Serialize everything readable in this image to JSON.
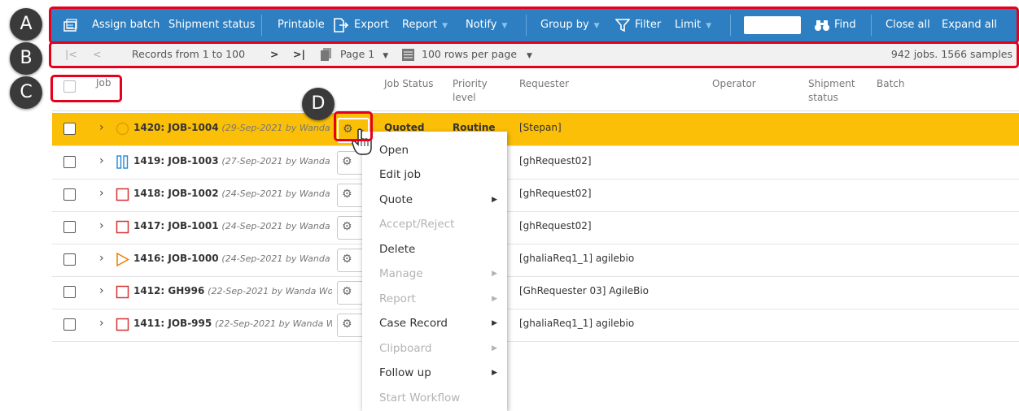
{
  "colors": {
    "toolbar": "#2d7fc1",
    "selected_row": "#fbbf08",
    "callout_border": "#e5001c",
    "badge": "#3a3a3a"
  },
  "callouts": {
    "a": "A",
    "b": "B",
    "c": "C",
    "d": "D"
  },
  "toolbar": {
    "assign_batch": "Assign batch",
    "shipment_status": "Shipment status",
    "printable": "Printable",
    "export": "Export",
    "report": "Report",
    "notify": "Notify",
    "group_by": "Group by",
    "filter": "Filter",
    "limit": "Limit",
    "find_value": "",
    "find": "Find",
    "close_all": "Close all",
    "expand_all": "Expand all"
  },
  "pager": {
    "records": "Records from 1 to 100",
    "page": "Page 1",
    "rows_per_page": "100 rows per page",
    "summary": "942 jobs. 1566 samples"
  },
  "columns": {
    "job": "Job",
    "job_status": "Job Status",
    "priority": "Priority level",
    "requester": "Requester",
    "operator": "Operator",
    "shipment": "Shipment status",
    "batch": "Batch"
  },
  "rows": [
    {
      "id": "1420: JOB-1004",
      "meta": "(29-Sep-2021 by Wanda Won",
      "status": "Quoted",
      "priority": "Routine",
      "requester": "[Stepan]",
      "icon": "circle-outline-icon"
    },
    {
      "id": "1419: JOB-1003",
      "meta": "(27-Sep-2021 by Wanda Wong",
      "requester": "[ghRequest02]",
      "icon": "pause-icon"
    },
    {
      "id": "1418: JOB-1002",
      "meta": "(24-Sep-2021 by Wanda Wong",
      "requester": "[ghRequest02]",
      "icon": "square-outline-icon"
    },
    {
      "id": "1417: JOB-1001",
      "meta": "(24-Sep-2021 by Wanda Wong",
      "requester": "[ghRequest02]",
      "icon": "square-outline-icon"
    },
    {
      "id": "1416: JOB-1000",
      "meta": "(24-Sep-2021 by Wanda Wong",
      "requester": "[ghaliaReq1_1] agilebio",
      "icon": "play-outline-icon"
    },
    {
      "id": "1412: GH996",
      "meta": "(22-Sep-2021 by Wanda Wong)",
      "requester": "[GhRequester 03] AgileBio",
      "icon": "square-outline-icon"
    },
    {
      "id": "1411: JOB-995",
      "meta": "(22-Sep-2021 by Wanda Wong)",
      "requester": "[ghaliaReq1_1] agilebio",
      "icon": "square-outline-icon"
    }
  ],
  "menu": [
    {
      "label": "Open",
      "disabled": false,
      "submenu": false
    },
    {
      "label": "Edit job",
      "disabled": false,
      "submenu": false
    },
    {
      "label": "Quote",
      "disabled": false,
      "submenu": true
    },
    {
      "label": "Accept/Reject",
      "disabled": true,
      "submenu": false
    },
    {
      "label": "Delete",
      "disabled": false,
      "submenu": false
    },
    {
      "label": "Manage",
      "disabled": true,
      "submenu": true
    },
    {
      "label": "Report",
      "disabled": true,
      "submenu": true
    },
    {
      "label": "Case Record",
      "disabled": false,
      "submenu": true
    },
    {
      "label": "Clipboard",
      "disabled": true,
      "submenu": true
    },
    {
      "label": "Follow up",
      "disabled": false,
      "submenu": true
    },
    {
      "label": "Start Workflow",
      "disabled": true,
      "submenu": false
    }
  ]
}
